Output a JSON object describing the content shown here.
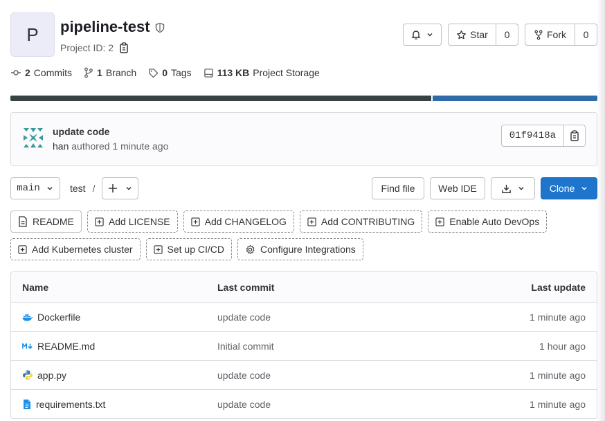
{
  "project": {
    "avatar_letter": "P",
    "name": "pipeline-test",
    "id_label": "Project ID: 2"
  },
  "actions": {
    "star_label": "Star",
    "star_count": "0",
    "fork_label": "Fork",
    "fork_count": "0"
  },
  "stats": {
    "commits_count": "2",
    "commits_label": "Commits",
    "branch_count": "1",
    "branch_label": "Branch",
    "tags_count": "0",
    "tags_label": "Tags",
    "storage_size": "113 KB",
    "storage_label": "Project Storage"
  },
  "languages": {
    "colors": [
      "#384245",
      "#2f6ba9"
    ]
  },
  "commit": {
    "title": "update code",
    "author": "han",
    "authored_text": " authored 1 minute ago",
    "sha": "01f9418a"
  },
  "toolbar": {
    "branch": "main",
    "path": "test",
    "path_sep": "/",
    "find_file": "Find file",
    "web_ide": "Web IDE",
    "clone": "Clone"
  },
  "suggestions": {
    "row1": [
      "README",
      "Add LICENSE",
      "Add CHANGELOG",
      "Add CONTRIBUTING",
      "Enable Auto DevOps"
    ],
    "row2": [
      "Add Kubernetes cluster",
      "Set up CI/CD",
      "Configure Integrations"
    ]
  },
  "table": {
    "headers": {
      "name": "Name",
      "last_commit": "Last commit",
      "last_update": "Last update"
    },
    "rows": [
      {
        "name": "Dockerfile",
        "icon": "docker-icon",
        "commit": "update code",
        "updated": "1 minute ago"
      },
      {
        "name": "README.md",
        "icon": "markdown-icon",
        "commit": "Initial commit",
        "updated": "1 hour ago"
      },
      {
        "name": "app.py",
        "icon": "python-icon",
        "commit": "update code",
        "updated": "1 minute ago"
      },
      {
        "name": "requirements.txt",
        "icon": "text-file-icon",
        "commit": "update code",
        "updated": "1 minute ago"
      }
    ]
  },
  "colors": {
    "accent": "#1f75cb",
    "text": "#333238",
    "muted": "#626168"
  }
}
